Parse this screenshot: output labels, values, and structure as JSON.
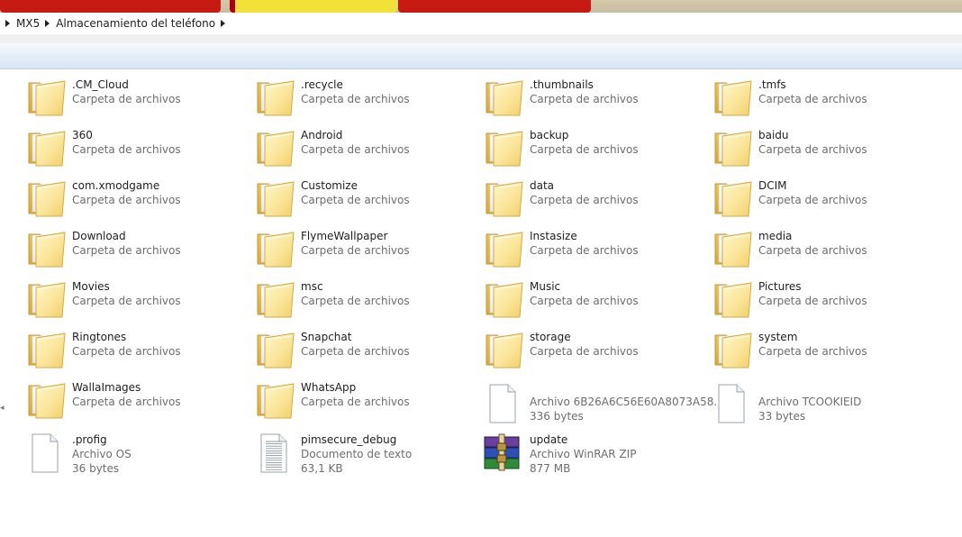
{
  "address": {
    "crumbs": [
      "MX5",
      "Almacenamiento del teléfono"
    ]
  },
  "folders": [
    {
      "name": ".CM_Cloud",
      "type": "Carpeta de archivos"
    },
    {
      "name": ".recycle",
      "type": "Carpeta de archivos"
    },
    {
      "name": ".thumbnails",
      "type": "Carpeta de archivos"
    },
    {
      "name": ".tmfs",
      "type": "Carpeta de archivos"
    },
    {
      "name": "360",
      "type": "Carpeta de archivos"
    },
    {
      "name": "Android",
      "type": "Carpeta de archivos"
    },
    {
      "name": "backup",
      "type": "Carpeta de archivos"
    },
    {
      "name": "baidu",
      "type": "Carpeta de archivos"
    },
    {
      "name": "com.xmodgame",
      "type": "Carpeta de archivos"
    },
    {
      "name": "Customize",
      "type": "Carpeta de archivos"
    },
    {
      "name": "data",
      "type": "Carpeta de archivos"
    },
    {
      "name": "DCIM",
      "type": "Carpeta de archivos"
    },
    {
      "name": "Download",
      "type": "Carpeta de archivos"
    },
    {
      "name": "FlymeWallpaper",
      "type": "Carpeta de archivos"
    },
    {
      "name": "Instasize",
      "type": "Carpeta de archivos"
    },
    {
      "name": "media",
      "type": "Carpeta de archivos"
    },
    {
      "name": "Movies",
      "type": "Carpeta de archivos"
    },
    {
      "name": "msc",
      "type": "Carpeta de archivos"
    },
    {
      "name": "Music",
      "type": "Carpeta de archivos"
    },
    {
      "name": "Pictures",
      "type": "Carpeta de archivos"
    },
    {
      "name": "Ringtones",
      "type": "Carpeta de archivos"
    },
    {
      "name": "Snapchat",
      "type": "Carpeta de archivos"
    },
    {
      "name": "storage",
      "type": "Carpeta de archivos"
    },
    {
      "name": "system",
      "type": "Carpeta de archivos"
    },
    {
      "name": "WallaImages",
      "type": "Carpeta de archivos"
    },
    {
      "name": "WhatsApp",
      "type": "Carpeta de archivos"
    }
  ],
  "files": [
    {
      "icon": "blank-file-icon",
      "line1": "Archivo 6B26A6C56E60A8073A58...",
      "line2": "336 bytes"
    },
    {
      "icon": "blank-file-icon",
      "line1": "Archivo TCOOKIEID",
      "line2": "33 bytes"
    },
    {
      "icon": "blank-file-icon",
      "name": ".profig",
      "line1": "Archivo OS",
      "line2": "36 bytes"
    },
    {
      "icon": "text-document-icon",
      "name": "pimsecure_debug",
      "line1": "Documento de texto",
      "line2": "63,1 KB"
    },
    {
      "icon": "winrar-archive-icon",
      "name": "update",
      "line1": "Archivo WinRAR ZIP",
      "line2": "877 MB"
    }
  ]
}
